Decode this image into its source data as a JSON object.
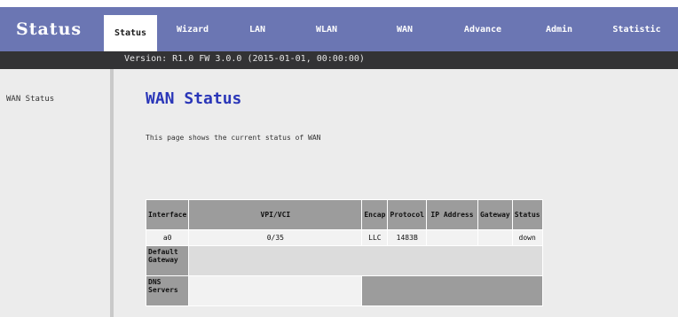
{
  "brand": "Status",
  "nav": {
    "items": [
      {
        "label": "Status",
        "active": true
      },
      {
        "label": "Wizard",
        "active": false
      },
      {
        "label": "LAN",
        "active": false
      },
      {
        "label": "WLAN",
        "active": false
      },
      {
        "label": "WAN",
        "active": false
      },
      {
        "label": "Advance",
        "active": false
      },
      {
        "label": "Admin",
        "active": false
      },
      {
        "label": "Statistic",
        "active": false
      }
    ]
  },
  "subbar": {
    "text": "Version: R1.0 FW 3.0.0 (2015-01-01, 00:00:00)"
  },
  "sidebar": {
    "items": [
      {
        "label": "WAN Status"
      }
    ]
  },
  "main": {
    "title": "WAN Status",
    "description": "This page shows the current status of WAN"
  },
  "table": {
    "headers": [
      "Interface",
      "VPI/VCI",
      "Encap",
      "Protocol",
      "IP Address",
      "Gateway",
      "Status"
    ],
    "rows": [
      {
        "interface": "a0",
        "vpi_vci": "0/35",
        "encap": "LLC",
        "protocol": "1483B",
        "ip": "",
        "gateway": "",
        "status": "down"
      }
    ],
    "default_gateway_label": "Default Gateway",
    "dns_servers_label": "DNS Servers",
    "default_gateway_value": "",
    "dns_servers_value": ""
  },
  "colors": {
    "header": "#6b76b3",
    "subbar": "#333335",
    "title": "#2a36b8",
    "table_head": "#9c9c9c",
    "panel": "#ececec"
  }
}
